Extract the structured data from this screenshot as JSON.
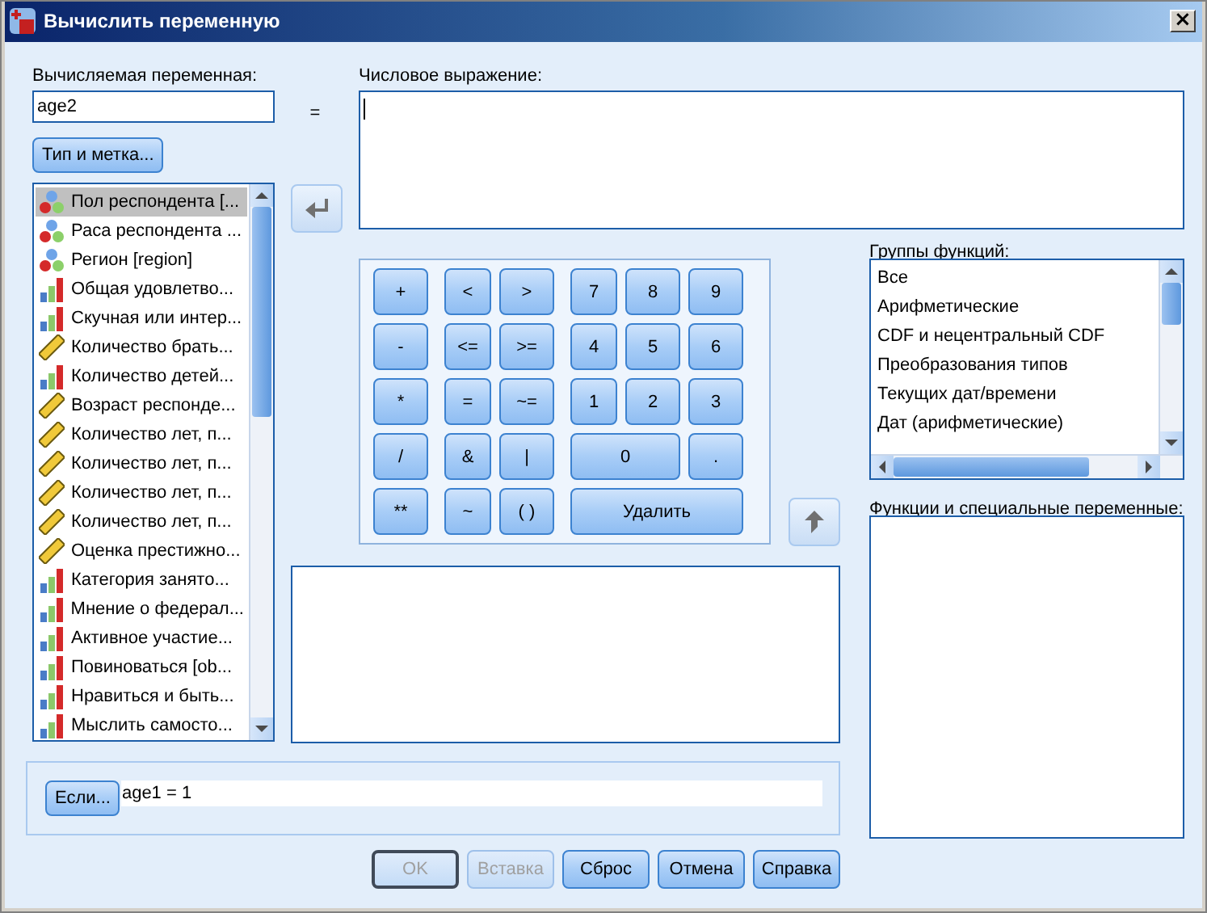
{
  "window": {
    "title": "Вычислить переменную",
    "close": "×"
  },
  "target": {
    "label": "Вычисляемая переменная:",
    "value": "age2"
  },
  "equals": "=",
  "type_button": "Тип и метка...",
  "expression": {
    "label": "Числовое выражение:"
  },
  "variables": [
    {
      "name": "Пол респондента [...",
      "kind": "nominal",
      "selected": true
    },
    {
      "name": "Раса респондента ...",
      "kind": "nominal",
      "selected": false
    },
    {
      "name": "Регион [region]",
      "kind": "nominal",
      "selected": false
    },
    {
      "name": "Общая удовлетво...",
      "kind": "ordinal",
      "selected": false
    },
    {
      "name": "Скучная или интер...",
      "kind": "ordinal",
      "selected": false
    },
    {
      "name": "Количество брать...",
      "kind": "scale",
      "selected": false
    },
    {
      "name": "Количество детей...",
      "kind": "ordinal",
      "selected": false
    },
    {
      "name": "Возраст респонде...",
      "kind": "scale",
      "selected": false
    },
    {
      "name": "Количество лет, п...",
      "kind": "scale",
      "selected": false
    },
    {
      "name": "Количество лет, п...",
      "kind": "scale",
      "selected": false
    },
    {
      "name": "Количество лет, п...",
      "kind": "scale",
      "selected": false
    },
    {
      "name": "Количество лет, п...",
      "kind": "scale",
      "selected": false
    },
    {
      "name": "Оценка престижно...",
      "kind": "scale",
      "selected": false
    },
    {
      "name": "Категория занято...",
      "kind": "ordinal",
      "selected": false
    },
    {
      "name": "Мнение о федерал...",
      "kind": "ordinal",
      "selected": false
    },
    {
      "name": "Активное участие...",
      "kind": "ordinal",
      "selected": false
    },
    {
      "name": "Повиноваться [ob...",
      "kind": "ordinal",
      "selected": false
    },
    {
      "name": "Нравиться и быть...",
      "kind": "ordinal",
      "selected": false
    },
    {
      "name": "Мыслить самосто...",
      "kind": "ordinal",
      "selected": false
    }
  ],
  "keypad": [
    {
      "label": "+",
      "kind": "key"
    },
    {
      "label": "<",
      "kind": "key"
    },
    {
      "label": ">",
      "kind": "key"
    },
    {
      "label": "7",
      "kind": "key"
    },
    {
      "label": "8",
      "kind": "key"
    },
    {
      "label": "9",
      "kind": "key"
    },
    {
      "label": "-",
      "kind": "key"
    },
    {
      "label": "<=",
      "kind": "key"
    },
    {
      "label": ">=",
      "kind": "key"
    },
    {
      "label": "4",
      "kind": "key"
    },
    {
      "label": "5",
      "kind": "key"
    },
    {
      "label": "6",
      "kind": "key"
    },
    {
      "label": "*",
      "kind": "key"
    },
    {
      "label": "=",
      "kind": "key"
    },
    {
      "label": "~=",
      "kind": "key"
    },
    {
      "label": "1",
      "kind": "key"
    },
    {
      "label": "2",
      "kind": "key"
    },
    {
      "label": "3",
      "kind": "key"
    },
    {
      "label": "/",
      "kind": "key"
    },
    {
      "label": "&",
      "kind": "key"
    },
    {
      "label": "|",
      "kind": "key"
    },
    {
      "label": "0",
      "kind": "zero"
    },
    {
      "label": ".",
      "kind": "key"
    },
    {
      "label": "**",
      "kind": "key"
    },
    {
      "label": "~",
      "kind": "key"
    },
    {
      "label": "( )",
      "kind": "key"
    },
    {
      "label": "Удалить",
      "kind": "delete"
    }
  ],
  "function_groups": {
    "label": "Группы функций:",
    "items": [
      {
        "label": "Все",
        "selected": false
      },
      {
        "label": "Арифметические",
        "selected": false
      },
      {
        "label": "CDF и нецентральный CDF",
        "selected": false
      },
      {
        "label": "Преобразования типов",
        "selected": false
      },
      {
        "label": "Текущих дат/времени",
        "selected": false
      },
      {
        "label": "Дат (арифметические)",
        "selected": false
      }
    ]
  },
  "functions": {
    "label": "Функции и специальные переменные:"
  },
  "condition": {
    "button": "Если...",
    "value": "age1 = 1"
  },
  "buttons": [
    {
      "label": "OK",
      "disabled": true,
      "focused": true
    },
    {
      "label": "Вставка",
      "disabled": true,
      "focused": false
    },
    {
      "label": "Сброс",
      "disabled": false,
      "focused": false
    },
    {
      "label": "Отмена",
      "disabled": false,
      "focused": false
    },
    {
      "label": "Справка",
      "disabled": false,
      "focused": false
    }
  ]
}
